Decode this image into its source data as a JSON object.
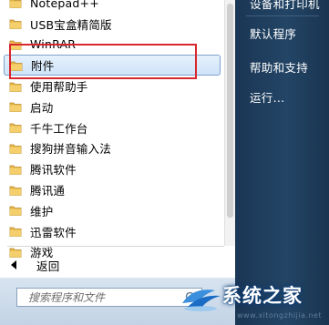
{
  "start_menu": {
    "programs": [
      {
        "label": "Notepad++",
        "icon": "folder-icon"
      },
      {
        "label": "USB宝盒精简版",
        "icon": "folder-icon"
      },
      {
        "label": "WinRAR",
        "icon": "folder-icon"
      },
      {
        "label": "附件",
        "icon": "folder-icon",
        "highlighted": true
      },
      {
        "label": "使用帮助手",
        "icon": "folder-icon"
      },
      {
        "label": "启动",
        "icon": "folder-icon"
      },
      {
        "label": "千牛工作台",
        "icon": "folder-icon"
      },
      {
        "label": "搜狗拼音输入法",
        "icon": "folder-icon"
      },
      {
        "label": "腾讯软件",
        "icon": "folder-icon"
      },
      {
        "label": "腾讯通",
        "icon": "folder-icon"
      },
      {
        "label": "维护",
        "icon": "folder-icon"
      },
      {
        "label": "迅雷软件",
        "icon": "folder-icon"
      },
      {
        "label": "游戏",
        "icon": "folder-icon"
      }
    ],
    "back_label": "返回",
    "search_placeholder": "搜索程序和文件"
  },
  "right_panel": {
    "items": [
      {
        "label": "设备和打印机"
      },
      {
        "label": "默认程序"
      },
      {
        "label": "帮助和支持"
      },
      {
        "label": "运行..."
      }
    ]
  },
  "watermark": {
    "text": "系统之家",
    "url": "www.xitongzhijia.net"
  },
  "colors": {
    "folder": "#e8b64a",
    "highlight_outline": "#d8272d",
    "right_pane": "#234566"
  }
}
